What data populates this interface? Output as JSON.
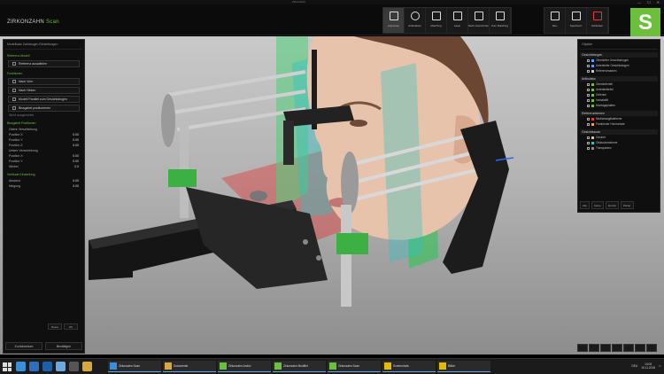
{
  "window": {
    "title": "ZirkonZahn"
  },
  "brand": {
    "name": "ZIRKONZAHN",
    "product": "Scan"
  },
  "toolbar": {
    "groups": [
      [
        {
          "label": "Anpassen",
          "icon": "grid-icon",
          "active": true
        },
        {
          "label": "Artikulation",
          "icon": "rotate-icon",
          "active": false
        },
        {
          "label": "Matching",
          "icon": "matching-icon",
          "active": false
        },
        {
          "label": "Laser",
          "icon": "laser-icon",
          "active": false
        },
        {
          "label": "Nach oben/Unten",
          "icon": "expand-icon",
          "active": false
        },
        {
          "label": "Zum Matching",
          "icon": "target-icon",
          "active": false
        }
      ],
      [
        {
          "label": "Neu",
          "icon": "new-icon",
          "active": false
        },
        {
          "label": "Speichern",
          "icon": "save-icon",
          "active": false
        },
        {
          "label": "Schließen",
          "icon": "close-icon",
          "active": false
        }
      ]
    ],
    "logo_letter": "S"
  },
  "left_panel": {
    "title": "Modellsatz Zahnbogen Einstellungen",
    "sections": [
      {
        "heading": "Referenz-Modell",
        "buttons": [
          "Referenz auswählen"
        ]
      },
      {
        "heading": "Funktionen",
        "buttons": [
          "Nach Vorn",
          "Nach Hinten",
          "Modell Parallel zum Gesichtsbogen",
          "Bissgabel positionieren"
        ]
      }
    ],
    "dim_label": "Nicht ausgerichtet",
    "offset_heading": "Bissgabel Positionen",
    "offset_rows": [
      {
        "label": "Obere Verschiebung",
        "value": ""
      },
      {
        "label": "Position X",
        "value": "0.00"
      },
      {
        "label": "Position Y",
        "value": "0.00"
      },
      {
        "label": "Position Z",
        "value": "0.00"
      },
      {
        "label": "Untere Verschiebung",
        "value": ""
      },
      {
        "label": "Position X",
        "value": "0.00"
      },
      {
        "label": "Position Y",
        "value": "0.00"
      },
      {
        "label": "Winkel",
        "value": "0.0"
      }
    ],
    "vertical_heading": "Vertikale Einstellung",
    "vertical_rows": [
      {
        "label": "Abstand",
        "value": "0.00"
      },
      {
        "label": "Neigung",
        "value": "0.00"
      }
    ],
    "small_buttons": [
      "Reset",
      "OK"
    ],
    "footer": [
      "Zurücksetzen",
      "Bestätigen"
    ]
  },
  "right_panel": {
    "title": "Objekte",
    "groups": [
      {
        "heading": "Gesichtsbogen",
        "items": [
          {
            "label": "Oberkiefer Gesichtsbogen",
            "swatch": "#4aa3ff"
          },
          {
            "label": "Unterkiefer Gesichtsbogen",
            "swatch": "#4aa3ff"
          },
          {
            "label": "Referenzmarken",
            "swatch": "#cccccc"
          }
        ]
      },
      {
        "heading": "Artikulator",
        "items": [
          {
            "label": "Oberkieferteil",
            "swatch": "#6cbf3a"
          },
          {
            "label": "Unterkieferteil",
            "swatch": "#6cbf3a"
          },
          {
            "label": "Gelenke",
            "swatch": "#6cbf3a"
          },
          {
            "label": "Inzisalstift",
            "swatch": "#6cbf3a"
          },
          {
            "label": "Montageplatten",
            "swatch": "#6cbf3a"
          }
        ]
      },
      {
        "heading": "Referenzebenen",
        "items": [
          {
            "label": "Mediansagittalebene",
            "swatch": "#e03a3a"
          },
          {
            "label": "Frankfurter Horizontale",
            "swatch": "#ff9a3a"
          }
        ]
      },
      {
        "heading": "Gesichtsscan",
        "items": [
          {
            "label": "Gesicht",
            "swatch": "#e6c2a8"
          },
          {
            "label": "Okklusionsebene",
            "swatch": "#28c2c2"
          },
          {
            "label": "Transparenz",
            "swatch": "#888888"
          }
        ]
      }
    ],
    "tools": [
      "Alle",
      "Keine",
      "Zurück",
      "Weiter"
    ]
  },
  "taskbar": {
    "pinned": [
      "explorer-icon",
      "browser-icon",
      "mail-icon",
      "store-icon",
      "settings-icon",
      "folder-icon"
    ],
    "tasks": [
      {
        "label": "Zirkonzahn.Scan",
        "color": "#3a8fd8"
      },
      {
        "label": "Dokumente",
        "color": "#d8a93a"
      },
      {
        "label": "Zirkonzahn.Archiv",
        "color": "#6cbf3a"
      },
      {
        "label": "Zirkonzahn Modifier",
        "color": "#6cbf3a"
      },
      {
        "label": "Zirkonzahn.Scan",
        "color": "#6cbf3a"
      },
      {
        "label": "Screenshots",
        "color": "#e6b800"
      },
      {
        "label": "Bilder",
        "color": "#e6b800"
      }
    ],
    "tray": {
      "lang": "DEU",
      "time": "14:05",
      "date": "15.11.2018"
    }
  },
  "colors": {
    "accent": "#6cbf3a",
    "panel_bg": "#0f0f0f",
    "viewport_top": "#c9c9c9",
    "viewport_bottom": "#8d8d8d"
  }
}
